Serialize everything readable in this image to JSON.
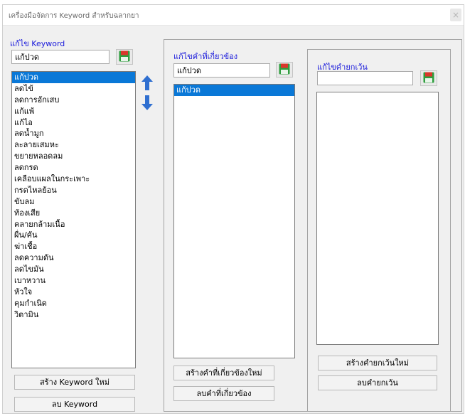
{
  "window": {
    "title": "เครื่องมือจัดการ Keyword สำหรับฉลากยา",
    "close_glyph": "×"
  },
  "keyword": {
    "heading": "แก้ไข Keyword",
    "edit_value": "แก้ปวด",
    "items": [
      "แก้ปวด",
      "ลดไข้",
      "ลดการอักเสบ",
      "แก้แพ้",
      "แก้ไอ",
      "ลดน้ำมูก",
      "ละลายเสมหะ",
      "ขยายหลอดลม",
      "ลดกรด",
      "เคลือบแผลในกระเพาะ",
      "กรดไหลย้อน",
      "ขับลม",
      "ท้องเสีย",
      "คลายกล้ามเนื้อ",
      "ผื่น/คัน",
      "ฆ่าเชื้อ",
      "ลดความดัน",
      "ลดไขมัน",
      "เบาหวาน",
      "หัวใจ",
      "คุมกำเนิด",
      "วิตามิน"
    ],
    "selected_index": 0,
    "create_button": "สร้าง Keyword ใหม่",
    "delete_button": "ลบ Keyword"
  },
  "related": {
    "heading": "แก้ไขคำที่เกี่ยวข้อง",
    "edit_value": "แก้ปวด",
    "items": [
      "แก้ปวด"
    ],
    "selected_index": 0,
    "create_button": "สร้างคำที่เกี่ยวข้องใหม่",
    "delete_button": "ลบคำที่เกี่ยวข้อง"
  },
  "exception": {
    "heading": "แก้ไขคำยกเว้น",
    "edit_value": "",
    "items": [],
    "create_button": "สร้างคำยกเว้นใหม่",
    "delete_button": "ลบคำยกเว้น"
  },
  "icons": {
    "save": "floppy-disk-icon",
    "move_up": "arrow-up-icon",
    "move_down": "arrow-down-icon"
  },
  "colors": {
    "heading_blue": "#1a1adb",
    "selection_blue": "#0a78d7",
    "arrow_blue": "#2f6fd0",
    "floppy_green": "#2e9e3e",
    "floppy_red": "#d9372b"
  }
}
